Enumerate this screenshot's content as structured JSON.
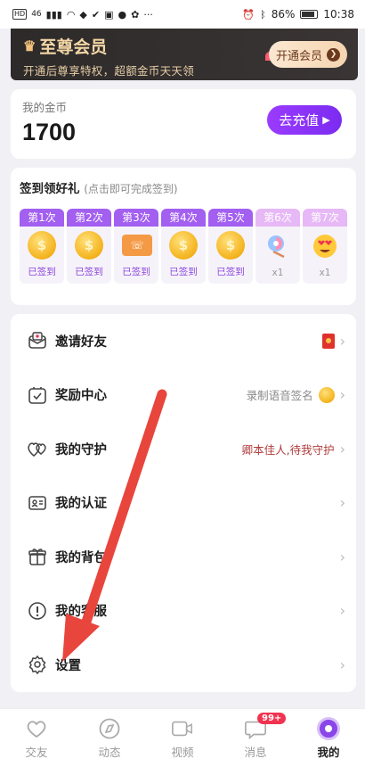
{
  "status_bar": {
    "left_label": "HD",
    "network": "46",
    "battery": "86%",
    "time": "10:38"
  },
  "vip": {
    "title": "至尊会员",
    "subtitle": "开通后尊享特权，超额金币天天领",
    "button_label": "开通会员"
  },
  "coins": {
    "label": "我的金币",
    "value": "1700",
    "recharge_label": "去充值"
  },
  "signin": {
    "title": "签到领好礼",
    "hint": "(点击即可完成签到)",
    "days": [
      {
        "label": "第1次",
        "status": "已签到",
        "icon": "coin-icon"
      },
      {
        "label": "第2次",
        "status": "已签到",
        "icon": "coin-icon"
      },
      {
        "label": "第3次",
        "status": "已签到",
        "icon": "call-card-icon"
      },
      {
        "label": "第4次",
        "status": "已签到",
        "icon": "coin-icon"
      },
      {
        "label": "第5次",
        "status": "已签到",
        "icon": "coin-icon"
      },
      {
        "label": "第6次",
        "status": "x1",
        "icon": "lollipop-icon"
      },
      {
        "label": "第7次",
        "status": "x1",
        "icon": "heart-eyes-emoji-icon"
      }
    ]
  },
  "menu": {
    "items": [
      {
        "label": "邀请好友",
        "right_text": "",
        "icon": "invite-icon"
      },
      {
        "label": "奖励中心",
        "right_text": "录制语音签名",
        "icon": "reward-icon"
      },
      {
        "label": "我的守护",
        "right_text": "卿本佳人,待我守护",
        "icon": "hearts-icon"
      },
      {
        "label": "我的认证",
        "right_text": "",
        "icon": "id-card-icon"
      },
      {
        "label": "我的背包",
        "right_text": "",
        "icon": "gift-box-icon"
      },
      {
        "label": "我的客服",
        "right_text": "",
        "icon": "exclamation-icon"
      },
      {
        "label": "设置",
        "right_text": "",
        "icon": "settings-gear-icon"
      }
    ]
  },
  "bottom_nav": {
    "items": [
      {
        "label": "交友",
        "icon": "heart-nav-icon"
      },
      {
        "label": "动态",
        "icon": "compass-nav-icon"
      },
      {
        "label": "视频",
        "icon": "video-nav-icon"
      },
      {
        "label": "消息",
        "icon": "message-nav-icon",
        "badge": "99+"
      },
      {
        "label": "我的",
        "icon": "profile-nav-icon",
        "active": true
      }
    ]
  },
  "colors": {
    "accent_purple": "#8d45e0",
    "vip_gold": "#f3d6a6",
    "annotation_arrow": "#e8453c"
  }
}
